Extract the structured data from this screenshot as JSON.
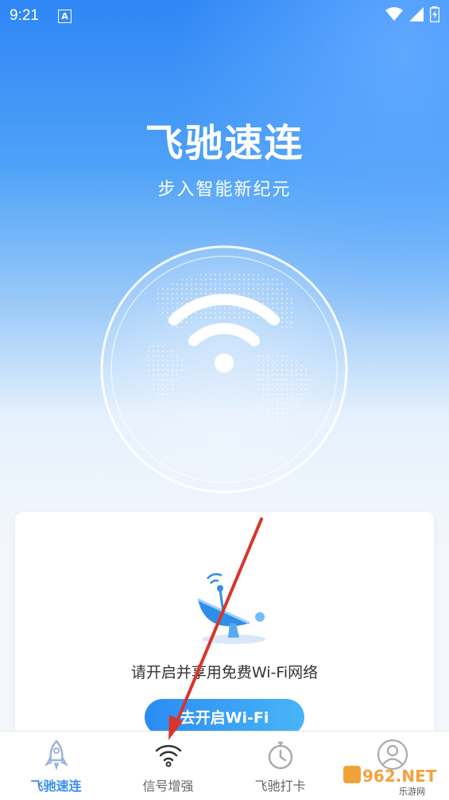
{
  "status_bar": {
    "time": "9:21",
    "notif_badge": "A"
  },
  "hero": {
    "title": "飞驰速连",
    "subtitle": "步入智能新纪元"
  },
  "card": {
    "message": "请开启并享用免费Wi-Fi网络",
    "button_label": "去开启Wi-Fi"
  },
  "tabs": [
    {
      "label": "飞驰速连",
      "icon": "rocket-icon",
      "active": true
    },
    {
      "label": "信号增强",
      "icon": "wifi-icon",
      "active": false
    },
    {
      "label": "飞驰打卡",
      "icon": "stopwatch-icon",
      "active": false
    },
    {
      "label": "",
      "icon": "profile-icon",
      "active": false
    }
  ],
  "watermark": {
    "text": "962.NET",
    "subtext": "乐游网"
  },
  "colors": {
    "accent": "#3b8ef0",
    "annotation_arrow": "#d9342b"
  }
}
